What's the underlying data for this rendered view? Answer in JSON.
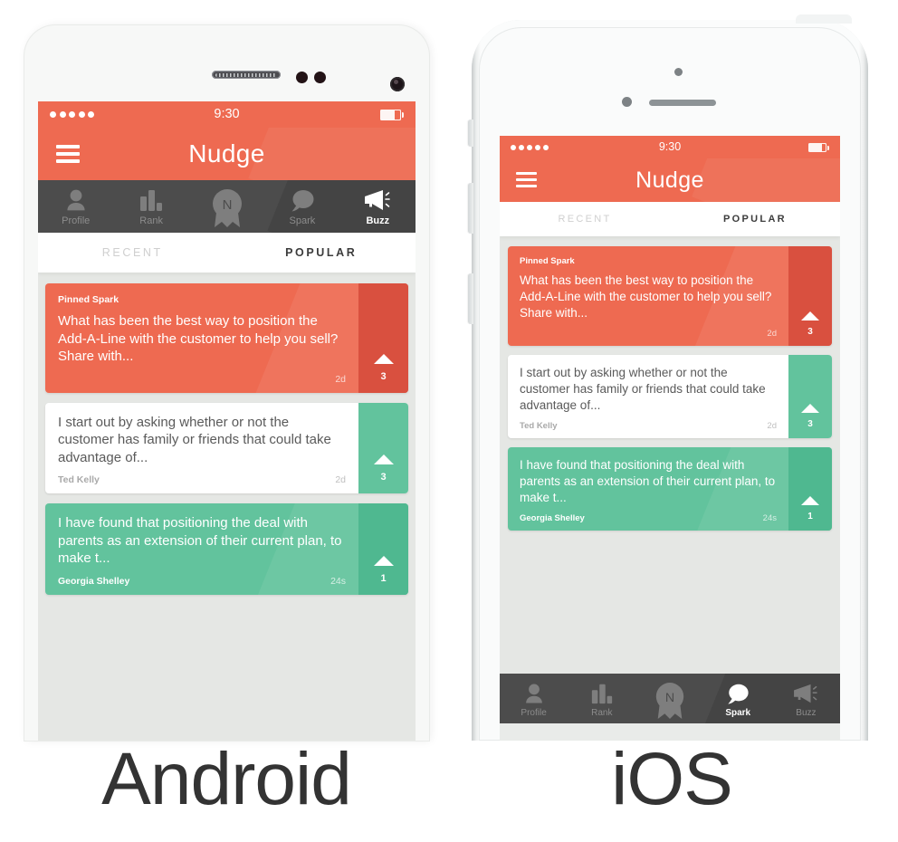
{
  "app": {
    "title": "Nudge",
    "brand_color": "#EE6A51",
    "green_color": "#62C39D",
    "dark_color": "#4C4C4C"
  },
  "captions": {
    "android": "Android",
    "ios": "iOS"
  },
  "status_bar": {
    "time": "9:30",
    "signal_dots": 5,
    "battery_icon": "battery-icon"
  },
  "nav": {
    "menu_icon": "hamburger-menu-icon",
    "title": "Nudge"
  },
  "segments": {
    "recent": "RECENT",
    "popular": "POPULAR",
    "active": "POPULAR"
  },
  "tabs": [
    {
      "label": "Profile",
      "icon": "person-icon"
    },
    {
      "label": "Rank",
      "icon": "bar-chart-icon"
    },
    {
      "label": "",
      "icon": "nudge-badge-icon"
    },
    {
      "label": "Spark",
      "icon": "speech-bubble-icon"
    },
    {
      "label": "Buzz",
      "icon": "megaphone-icon"
    }
  ],
  "android_active_tab": "Buzz",
  "ios_active_tab": "Spark",
  "cards": [
    {
      "style": "orange",
      "pinned_label": "Pinned Spark",
      "text": "What has been the best way to position the Add-A-Line with the customer to help you sell? Share with...",
      "author": "",
      "time": "2d",
      "votes": "3"
    },
    {
      "style": "light",
      "pinned_label": "",
      "text": "I start out by asking whether or not the customer has family or friends that could take advantage of...",
      "author": "Ted Kelly",
      "time": "2d",
      "votes": "3"
    },
    {
      "style": "green",
      "pinned_label": "",
      "text": "I have found that positioning the deal with parents as an extension of their current plan, to make t...",
      "author": "Georgia Shelley",
      "time": "24s",
      "votes": "1"
    }
  ]
}
